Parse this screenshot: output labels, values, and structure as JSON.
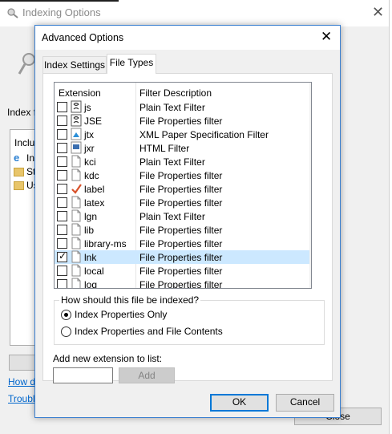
{
  "background_window": {
    "title": "Indexing Options",
    "index_label": "Index f",
    "list_header": "Incluc",
    "list_rows": [
      "In",
      "St",
      "Us"
    ],
    "link1": "How do",
    "link2": "Trouble",
    "close_button": "Close"
  },
  "dialog": {
    "title": "Advanced Options",
    "tabs": [
      {
        "label": "Index Settings",
        "active": false
      },
      {
        "label": "File Types",
        "active": true
      }
    ],
    "columns": [
      "Extension",
      "Filter Description"
    ],
    "rows": [
      {
        "checked": false,
        "icon": "script-file-icon",
        "ext": "js",
        "desc": "Plain Text Filter"
      },
      {
        "checked": false,
        "icon": "script-file-icon",
        "ext": "JSE",
        "desc": "File Properties filter"
      },
      {
        "checked": false,
        "icon": "xps-file-icon",
        "ext": "jtx",
        "desc": "XML Paper Specification Filter"
      },
      {
        "checked": false,
        "icon": "html-file-icon",
        "ext": "jxr",
        "desc": "HTML Filter"
      },
      {
        "checked": false,
        "icon": "blank-file-icon",
        "ext": "kci",
        "desc": "Plain Text Filter"
      },
      {
        "checked": false,
        "icon": "blank-file-icon",
        "ext": "kdc",
        "desc": "File Properties filter"
      },
      {
        "checked": false,
        "icon": "check-mark-icon",
        "ext": "label",
        "desc": "File Properties filter"
      },
      {
        "checked": false,
        "icon": "blank-file-icon",
        "ext": "latex",
        "desc": "File Properties filter"
      },
      {
        "checked": false,
        "icon": "blank-file-icon",
        "ext": "lgn",
        "desc": "Plain Text Filter"
      },
      {
        "checked": false,
        "icon": "blank-file-icon",
        "ext": "lib",
        "desc": "File Properties filter"
      },
      {
        "checked": false,
        "icon": "blank-file-icon",
        "ext": "library-ms",
        "desc": "File Properties filter"
      },
      {
        "checked": true,
        "icon": "blank-file-icon",
        "ext": "lnk",
        "desc": "File Properties filter",
        "selected": true
      },
      {
        "checked": false,
        "icon": "blank-file-icon",
        "ext": "local",
        "desc": "File Properties filter"
      },
      {
        "checked": false,
        "icon": "blank-file-icon",
        "ext": "log",
        "desc": "File Properties filter"
      }
    ],
    "how_indexed_label": "How should this file be indexed?",
    "radio_options": [
      {
        "label": "Index Properties Only",
        "selected": true
      },
      {
        "label": "Index Properties and File Contents",
        "selected": false
      }
    ],
    "add_ext_label": "Add new extension to list:",
    "add_ext_value": "",
    "add_button": "Add",
    "ok_button": "OK",
    "cancel_button": "Cancel"
  },
  "colors": {
    "accent": "#0078d7",
    "selection": "#cce8ff",
    "link": "#0066cc"
  }
}
